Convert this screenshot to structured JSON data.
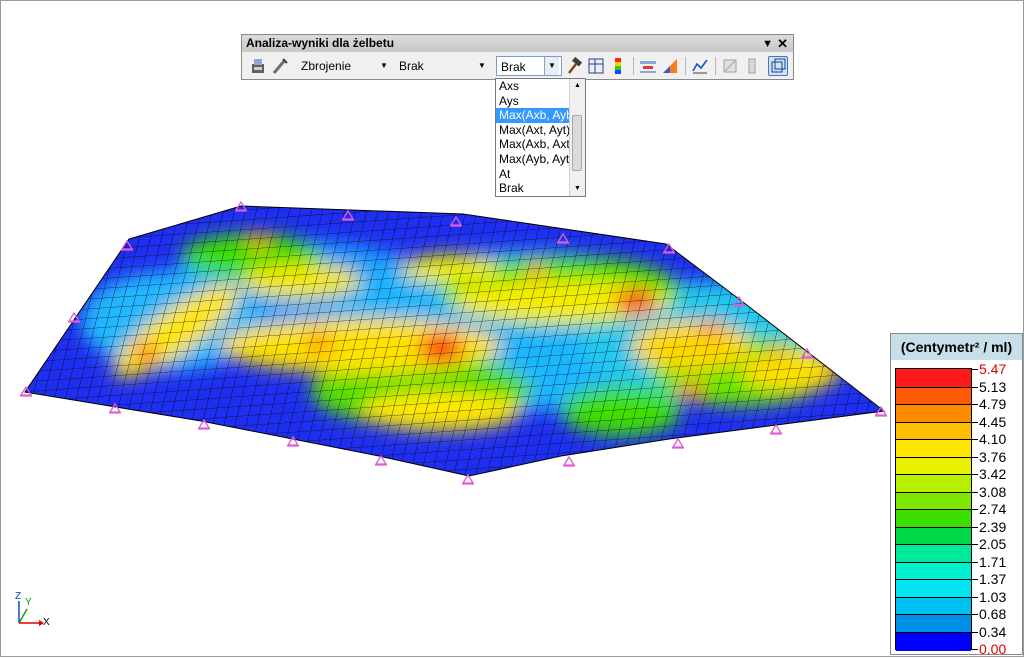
{
  "toolbar": {
    "title": "Analiza-wyniki dla żelbetu",
    "combo1": "Zbrojenie",
    "combo2": "Brak",
    "combo3": "Brak",
    "pin_glyph": "▼",
    "close_glyph": "✕"
  },
  "dropdown": {
    "options": [
      "Axs",
      "Ays",
      "Max(Axb, Ayb",
      "Max(Axt, Ayt)",
      "Max(Axb, Axt)",
      "Max(Ayb, Ayt",
      "At",
      "Brak"
    ],
    "selected_index": 2
  },
  "legend": {
    "title": "(Centymetr² / ml)",
    "values": [
      "5.47",
      "5.13",
      "4.79",
      "4.45",
      "4.10",
      "3.76",
      "3.42",
      "3.08",
      "2.74",
      "2.39",
      "2.05",
      "1.71",
      "1.37",
      "1.03",
      "0.68",
      "0.34",
      "0.00"
    ],
    "colors": [
      "#ff1a1a",
      "#ff5a0a",
      "#ff8c00",
      "#ffbf00",
      "#ffe600",
      "#e8f000",
      "#b8ee00",
      "#80e800",
      "#3ce000",
      "#00d84a",
      "#00e89a",
      "#00f0d0",
      "#00e6f0",
      "#00c0f0",
      "#0090e8",
      "#0000ff"
    ],
    "top_value_color": "#e00000",
    "bottom_value_color": "#e00000"
  },
  "axis": {
    "z_label": "Z",
    "y_label": "Y",
    "x_label": "X"
  },
  "colors": {
    "support": "#e05adc",
    "mesh_line": "#000000"
  }
}
